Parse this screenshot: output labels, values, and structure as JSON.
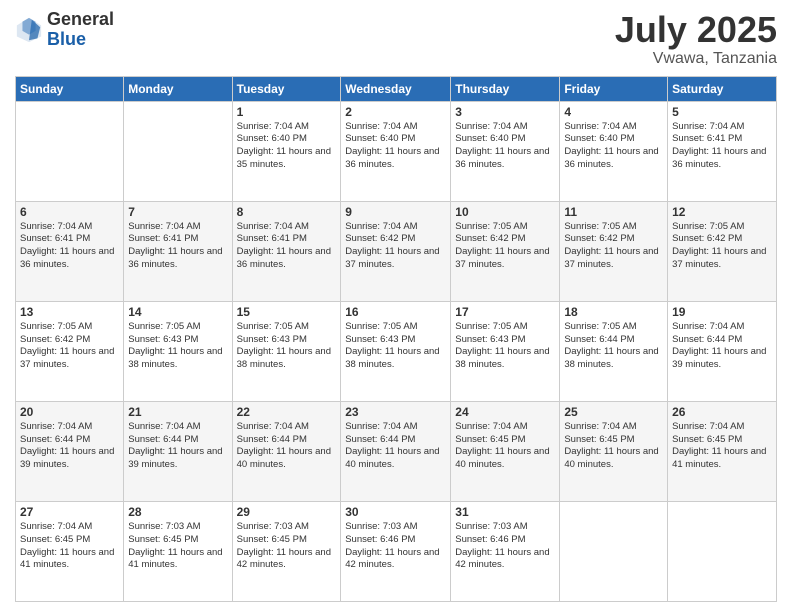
{
  "header": {
    "logo_general": "General",
    "logo_blue": "Blue",
    "title": "July 2025",
    "subtitle": "Vwawa, Tanzania"
  },
  "calendar": {
    "days_of_week": [
      "Sunday",
      "Monday",
      "Tuesday",
      "Wednesday",
      "Thursday",
      "Friday",
      "Saturday"
    ],
    "weeks": [
      [
        {
          "day": "",
          "detail": ""
        },
        {
          "day": "",
          "detail": ""
        },
        {
          "day": "1",
          "detail": "Sunrise: 7:04 AM\nSunset: 6:40 PM\nDaylight: 11 hours and 35 minutes."
        },
        {
          "day": "2",
          "detail": "Sunrise: 7:04 AM\nSunset: 6:40 PM\nDaylight: 11 hours and 36 minutes."
        },
        {
          "day": "3",
          "detail": "Sunrise: 7:04 AM\nSunset: 6:40 PM\nDaylight: 11 hours and 36 minutes."
        },
        {
          "day": "4",
          "detail": "Sunrise: 7:04 AM\nSunset: 6:40 PM\nDaylight: 11 hours and 36 minutes."
        },
        {
          "day": "5",
          "detail": "Sunrise: 7:04 AM\nSunset: 6:41 PM\nDaylight: 11 hours and 36 minutes."
        }
      ],
      [
        {
          "day": "6",
          "detail": "Sunrise: 7:04 AM\nSunset: 6:41 PM\nDaylight: 11 hours and 36 minutes."
        },
        {
          "day": "7",
          "detail": "Sunrise: 7:04 AM\nSunset: 6:41 PM\nDaylight: 11 hours and 36 minutes."
        },
        {
          "day": "8",
          "detail": "Sunrise: 7:04 AM\nSunset: 6:41 PM\nDaylight: 11 hours and 36 minutes."
        },
        {
          "day": "9",
          "detail": "Sunrise: 7:04 AM\nSunset: 6:42 PM\nDaylight: 11 hours and 37 minutes."
        },
        {
          "day": "10",
          "detail": "Sunrise: 7:05 AM\nSunset: 6:42 PM\nDaylight: 11 hours and 37 minutes."
        },
        {
          "day": "11",
          "detail": "Sunrise: 7:05 AM\nSunset: 6:42 PM\nDaylight: 11 hours and 37 minutes."
        },
        {
          "day": "12",
          "detail": "Sunrise: 7:05 AM\nSunset: 6:42 PM\nDaylight: 11 hours and 37 minutes."
        }
      ],
      [
        {
          "day": "13",
          "detail": "Sunrise: 7:05 AM\nSunset: 6:42 PM\nDaylight: 11 hours and 37 minutes."
        },
        {
          "day": "14",
          "detail": "Sunrise: 7:05 AM\nSunset: 6:43 PM\nDaylight: 11 hours and 38 minutes."
        },
        {
          "day": "15",
          "detail": "Sunrise: 7:05 AM\nSunset: 6:43 PM\nDaylight: 11 hours and 38 minutes."
        },
        {
          "day": "16",
          "detail": "Sunrise: 7:05 AM\nSunset: 6:43 PM\nDaylight: 11 hours and 38 minutes."
        },
        {
          "day": "17",
          "detail": "Sunrise: 7:05 AM\nSunset: 6:43 PM\nDaylight: 11 hours and 38 minutes."
        },
        {
          "day": "18",
          "detail": "Sunrise: 7:05 AM\nSunset: 6:44 PM\nDaylight: 11 hours and 38 minutes."
        },
        {
          "day": "19",
          "detail": "Sunrise: 7:04 AM\nSunset: 6:44 PM\nDaylight: 11 hours and 39 minutes."
        }
      ],
      [
        {
          "day": "20",
          "detail": "Sunrise: 7:04 AM\nSunset: 6:44 PM\nDaylight: 11 hours and 39 minutes."
        },
        {
          "day": "21",
          "detail": "Sunrise: 7:04 AM\nSunset: 6:44 PM\nDaylight: 11 hours and 39 minutes."
        },
        {
          "day": "22",
          "detail": "Sunrise: 7:04 AM\nSunset: 6:44 PM\nDaylight: 11 hours and 40 minutes."
        },
        {
          "day": "23",
          "detail": "Sunrise: 7:04 AM\nSunset: 6:44 PM\nDaylight: 11 hours and 40 minutes."
        },
        {
          "day": "24",
          "detail": "Sunrise: 7:04 AM\nSunset: 6:45 PM\nDaylight: 11 hours and 40 minutes."
        },
        {
          "day": "25",
          "detail": "Sunrise: 7:04 AM\nSunset: 6:45 PM\nDaylight: 11 hours and 40 minutes."
        },
        {
          "day": "26",
          "detail": "Sunrise: 7:04 AM\nSunset: 6:45 PM\nDaylight: 11 hours and 41 minutes."
        }
      ],
      [
        {
          "day": "27",
          "detail": "Sunrise: 7:04 AM\nSunset: 6:45 PM\nDaylight: 11 hours and 41 minutes."
        },
        {
          "day": "28",
          "detail": "Sunrise: 7:03 AM\nSunset: 6:45 PM\nDaylight: 11 hours and 41 minutes."
        },
        {
          "day": "29",
          "detail": "Sunrise: 7:03 AM\nSunset: 6:45 PM\nDaylight: 11 hours and 42 minutes."
        },
        {
          "day": "30",
          "detail": "Sunrise: 7:03 AM\nSunset: 6:46 PM\nDaylight: 11 hours and 42 minutes."
        },
        {
          "day": "31",
          "detail": "Sunrise: 7:03 AM\nSunset: 6:46 PM\nDaylight: 11 hours and 42 minutes."
        },
        {
          "day": "",
          "detail": ""
        },
        {
          "day": "",
          "detail": ""
        }
      ]
    ]
  }
}
